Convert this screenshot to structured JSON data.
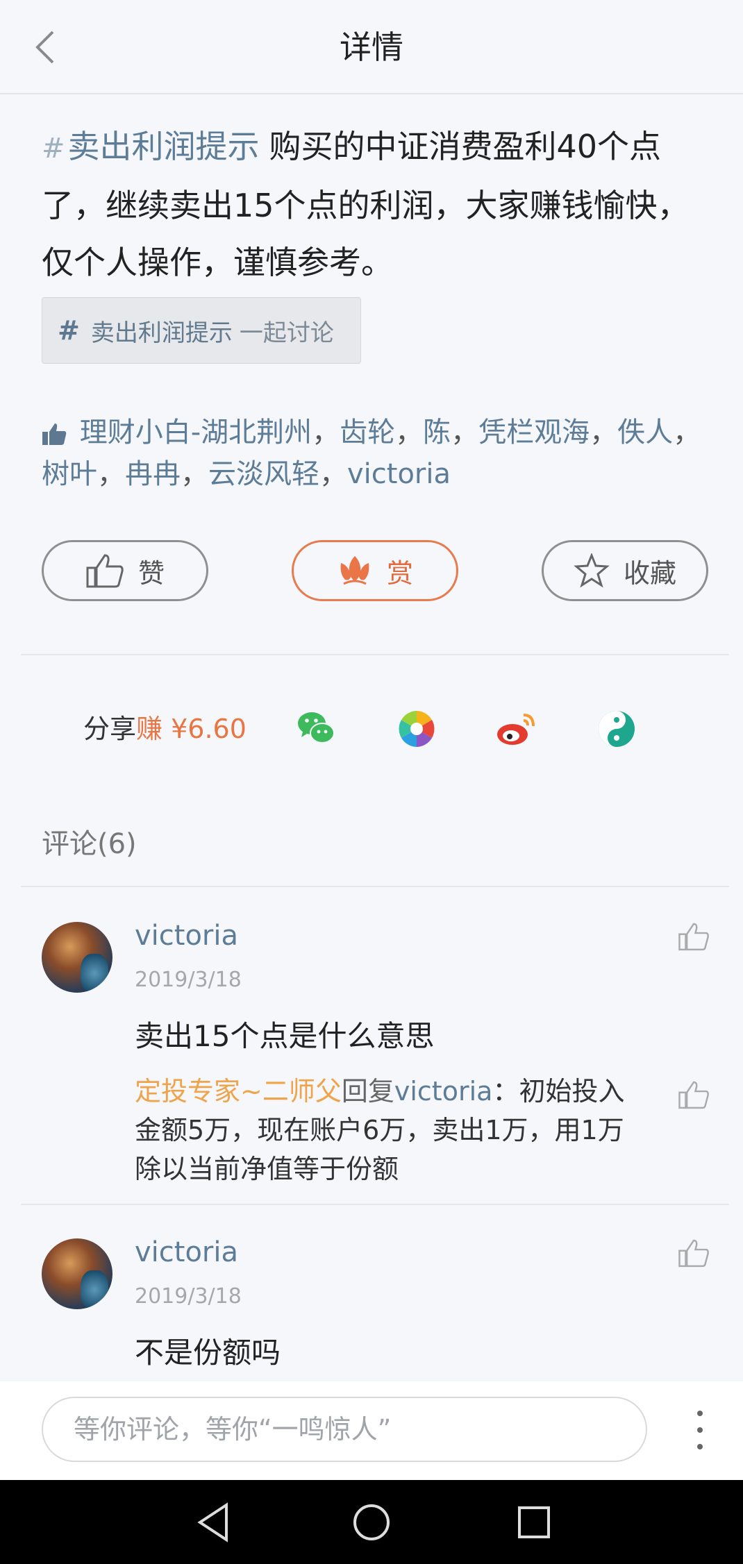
{
  "header": {
    "title": "详情"
  },
  "post": {
    "topic_hash": "#",
    "topic": "卖出利润提示",
    "text": "购买的中证消费盈利40个点了，继续卖出15个点的利润，大家赚钱愉快，仅个人操作，谨慎参考。"
  },
  "topic_chip": {
    "topic": "卖出利润提示",
    "suffix": "一起讨论"
  },
  "likers": [
    "理财小白-湖北荆州",
    "齿轮",
    "陈",
    "凭栏观海",
    "佚人",
    "树叶",
    "冉冉",
    "云淡风轻",
    "victoria"
  ],
  "likers_sep": "，",
  "actions": {
    "like": "赞",
    "reward": "赏",
    "collect": "收藏"
  },
  "share": {
    "label": "分享",
    "earn": "赚 ¥6.60"
  },
  "comments_title": "评论(6)",
  "comments": [
    {
      "user": "victoria",
      "date": "2019/3/18",
      "text": "卖出15个点是什么意思",
      "reply": {
        "from": "定投专家~二师父",
        "word": "回复",
        "to": "victoria",
        "colon": "：",
        "text": "初始投入金额5万，现在账户6万，卖出1万，用1万除以当前净值等于份额"
      }
    },
    {
      "user": "victoria",
      "date": "2019/3/18",
      "text": "不是份额吗"
    }
  ],
  "comment_input": {
    "placeholder": "等你评论，等你“一鸣惊人”"
  },
  "colors": {
    "accent": "#e87544",
    "link": "#5d7c97",
    "reply_from": "#efa34a",
    "wechat": "#3dbb5c",
    "weibo": "#e33b2e",
    "friends": "#1fa68e"
  }
}
